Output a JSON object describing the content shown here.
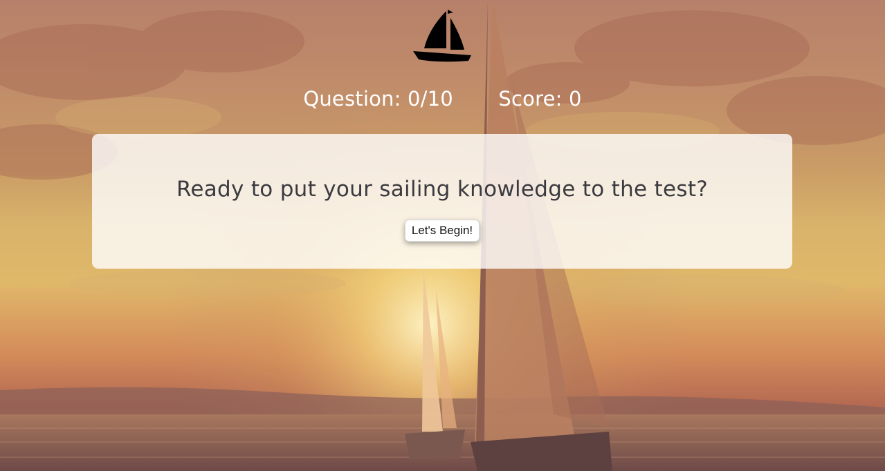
{
  "header": {
    "logo_icon": "sailboat-icon"
  },
  "stats": {
    "question_label": "Question:",
    "question_value": "0/10",
    "score_label": "Score:",
    "score_value": "0"
  },
  "intro_card": {
    "prompt": "Ready to put your sailing knowledge to the test?",
    "begin_button_label": "Let's Begin!"
  },
  "colors": {
    "card_background": "#ffffff",
    "stats_text": "#ffffff",
    "prompt_text": "#3a3a3f"
  }
}
